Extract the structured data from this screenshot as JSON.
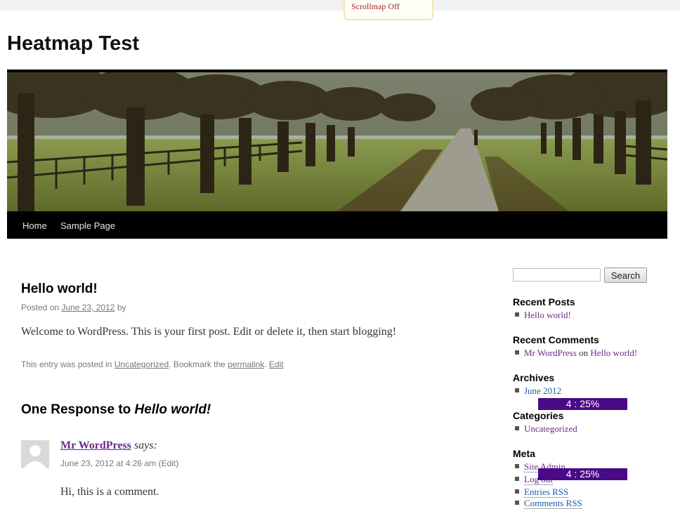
{
  "scrollmap": {
    "label": "Scrollmap Off"
  },
  "site": {
    "title": "Heatmap Test"
  },
  "nav": {
    "items": [
      "Home",
      "Sample Page"
    ]
  },
  "post": {
    "title": "Hello world!",
    "posted_on": "Posted on",
    "date": "June 23, 2012",
    "by": "by",
    "body": "Welcome to WordPress. This is your first post. Edit or delete it, then start blogging!",
    "footer_prefix": "This entry was posted in",
    "category": "Uncategorized",
    "bookmark_text": ". Bookmark the",
    "permalink": "permalink",
    "dot": ".",
    "edit": "Edit"
  },
  "comments": {
    "heading_prefix": "One Response to",
    "heading_post": "Hello world!",
    "author": "Mr WordPress",
    "says": "says:",
    "meta": "June 23, 2012 at 4:26 am",
    "edit": "(Edit)",
    "text": "Hi, this is a comment."
  },
  "sidebar": {
    "search_button": "Search",
    "recent_posts": {
      "title": "Recent Posts",
      "items": [
        "Hello world!"
      ]
    },
    "recent_comments": {
      "title": "Recent Comments",
      "author": "Mr WordPress",
      "on": "on",
      "post": "Hello world!"
    },
    "archives": {
      "title": "Archives",
      "items": [
        "June 2012"
      ]
    },
    "categories": {
      "title": "Categories",
      "items": [
        "Uncategorized"
      ]
    },
    "meta": {
      "title": "Meta",
      "items": [
        "Site Admin",
        "Log out",
        "Entries RSS",
        "Comments RSS"
      ]
    }
  },
  "heat_badges": [
    "4 : 25%",
    "4 : 25%"
  ],
  "colors": {
    "link_purple": "#6c2a8c",
    "link_blue": "#1a5ca8",
    "badge": "#4a0a86",
    "scrollmap_text": "#a0262a"
  }
}
